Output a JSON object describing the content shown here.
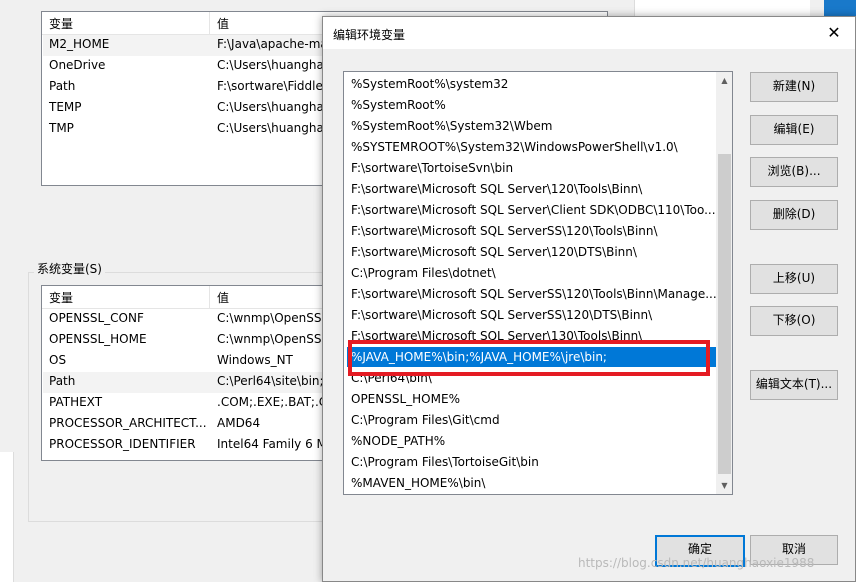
{
  "user_vars": {
    "headers": {
      "name": "变量",
      "value": "值"
    },
    "rows": [
      {
        "name": "M2_HOME",
        "value": "F:\\Java\\apache-ma"
      },
      {
        "name": "OneDrive",
        "value": "C:\\Users\\huanghai"
      },
      {
        "name": "Path",
        "value": "F:\\sortware\\Fiddle"
      },
      {
        "name": "TEMP",
        "value": "C:\\Users\\huanghai"
      },
      {
        "name": "TMP",
        "value": "C:\\Users\\huanghai"
      }
    ]
  },
  "system_vars": {
    "group_label": "系统变量(S)",
    "headers": {
      "name": "变量",
      "value": "值"
    },
    "rows": [
      {
        "name": "OPENSSL_CONF",
        "value": "C:\\wnmp\\OpenSSL"
      },
      {
        "name": "OPENSSL_HOME",
        "value": "C:\\wnmp\\OpenSSL"
      },
      {
        "name": "OS",
        "value": "Windows_NT"
      },
      {
        "name": "Path",
        "value": "C:\\Perl64\\site\\bin;C"
      },
      {
        "name": "PATHEXT",
        "value": ".COM;.EXE;.BAT;.CM"
      },
      {
        "name": "PROCESSOR_ARCHITECT...",
        "value": "AMD64"
      },
      {
        "name": "PROCESSOR_IDENTIFIER",
        "value": "Intel64 Family 6 M"
      }
    ]
  },
  "dialog": {
    "title": "编辑环境变量",
    "close_glyph": "✕",
    "paths": [
      "%SystemRoot%\\system32",
      "%SystemRoot%",
      "%SystemRoot%\\System32\\Wbem",
      "%SYSTEMROOT%\\System32\\WindowsPowerShell\\v1.0\\",
      "F:\\sortware\\TortoiseSvn\\bin",
      "F:\\sortware\\Microsoft SQL Server\\120\\Tools\\Binn\\",
      "F:\\sortware\\Microsoft SQL Server\\Client SDK\\ODBC\\110\\Too...",
      "F:\\sortware\\Microsoft SQL ServerSS\\120\\Tools\\Binn\\",
      "F:\\sortware\\Microsoft SQL Server\\120\\DTS\\Binn\\",
      "C:\\Program Files\\dotnet\\",
      "F:\\sortware\\Microsoft SQL ServerSS\\120\\Tools\\Binn\\Manage...",
      "F:\\sortware\\Microsoft SQL ServerSS\\120\\DTS\\Binn\\",
      "F:\\sortware\\Microsoft SQL Server\\130\\Tools\\Binn\\",
      "%JAVA_HOME%\\bin;%JAVA_HOME%\\jre\\bin;",
      "C:\\Perl64\\bin\\",
      "OPENSSL_HOME%",
      "C:\\Program Files\\Git\\cmd",
      "%NODE_PATH%",
      "C:\\Program Files\\TortoiseGit\\bin",
      "%MAVEN_HOME%\\bin\\"
    ],
    "selected_index": 13,
    "buttons": {
      "new": "新建(N)",
      "edit": "编辑(E)",
      "browse": "浏览(B)...",
      "delete": "删除(D)",
      "move_up": "上移(U)",
      "move_down": "下移(O)",
      "edit_text": "编辑文本(T)...",
      "ok": "确定",
      "cancel": "取消"
    },
    "scroll_up_glyph": "▲",
    "scroll_down_glyph": "▼"
  },
  "watermark": "https://blog.csdn.net/huanghaoxie1988",
  "colors": {
    "selection": "#0078d7",
    "highlight_box": "#e41b23"
  }
}
